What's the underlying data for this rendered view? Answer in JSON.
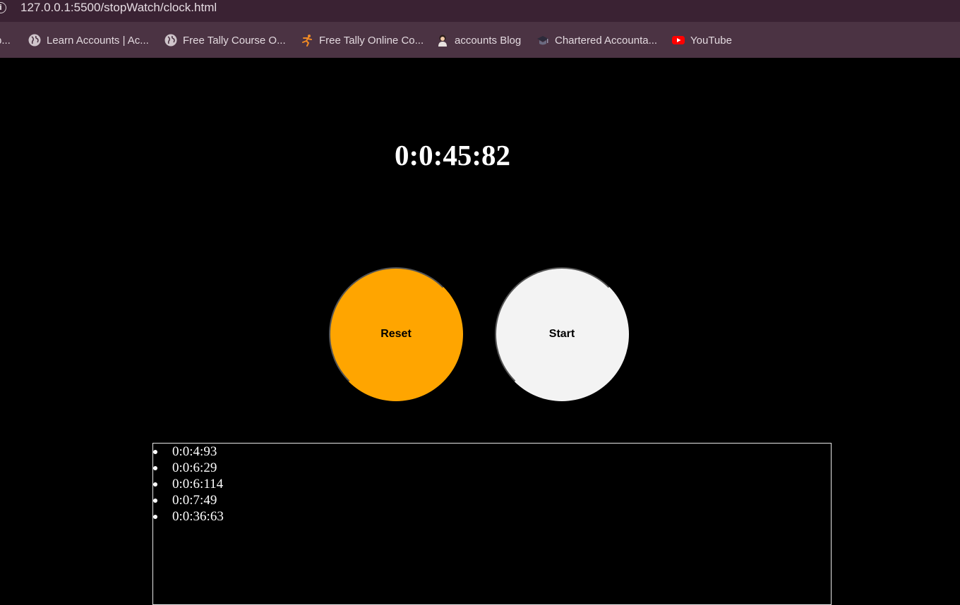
{
  "browser": {
    "url": "127.0.0.1:5500/stopWatch/clock.html",
    "bookmarks": [
      {
        "label": "p...",
        "icon": "none"
      },
      {
        "label": "Learn Accounts | Ac...",
        "icon": "globe-icon"
      },
      {
        "label": "Free Tally Course O...",
        "icon": "globe-icon"
      },
      {
        "label": "Free Tally Online Co...",
        "icon": "runner-icon"
      },
      {
        "label": "accounts Blog",
        "icon": "person-icon"
      },
      {
        "label": "Chartered Accounta...",
        "icon": "graduation-cap-icon"
      },
      {
        "label": "YouTube",
        "icon": "youtube-icon"
      }
    ]
  },
  "stopwatch": {
    "time": "0:0:45:82",
    "reset_label": "Reset",
    "start_label": "Start",
    "colors": {
      "reset": "#ffa500",
      "start": "#f3f3f3",
      "background": "#000000"
    }
  },
  "laps": [
    "0:0:4:93",
    "0:0:6:29",
    "0:0:6:114",
    "0:0:7:49",
    "0:0:36:63"
  ]
}
